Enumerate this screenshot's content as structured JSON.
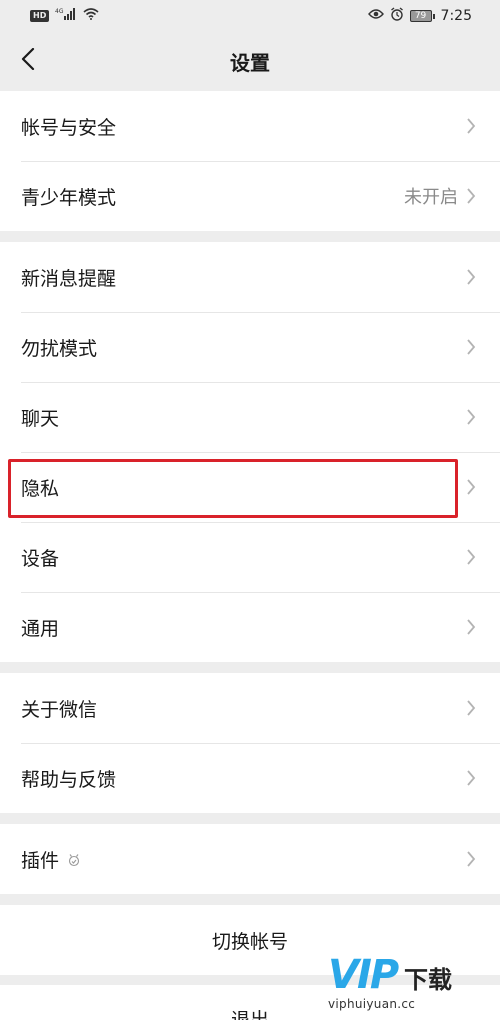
{
  "status_bar": {
    "network_badge": "HD",
    "signal_label": "4G",
    "battery_level": "79",
    "time": "7:25"
  },
  "nav": {
    "title": "设置"
  },
  "groups": {
    "account": [
      {
        "label": "帐号与安全",
        "value": ""
      },
      {
        "label": "青少年模式",
        "value": "未开启"
      }
    ],
    "general": [
      {
        "label": "新消息提醒"
      },
      {
        "label": "勿扰模式"
      },
      {
        "label": "聊天"
      },
      {
        "label": "隐私"
      },
      {
        "label": "设备"
      },
      {
        "label": "通用"
      }
    ],
    "about": [
      {
        "label": "关于微信"
      },
      {
        "label": "帮助与反馈"
      }
    ],
    "plugins": [
      {
        "label": "插件"
      }
    ]
  },
  "actions": {
    "switch_account": "切换帐号",
    "logout": "退出"
  },
  "watermark": {
    "logo_text": "VIP",
    "logo_suffix": "下载",
    "url": "viphuiyuan.cc"
  },
  "colors": {
    "background": "#ededed",
    "cell": "#ffffff",
    "highlight": "#d9222a",
    "secondary_text": "#8a8a8a",
    "watermark_blue": "#2aa7e8"
  },
  "icons": {
    "back": "chevron-left-icon",
    "row_arrow": "chevron-right-icon",
    "plugin_badge": "puzzle-icon",
    "eye": "eye-icon",
    "alarm": "alarm-icon",
    "wifi": "wifi-icon",
    "signal": "signal-icon"
  }
}
